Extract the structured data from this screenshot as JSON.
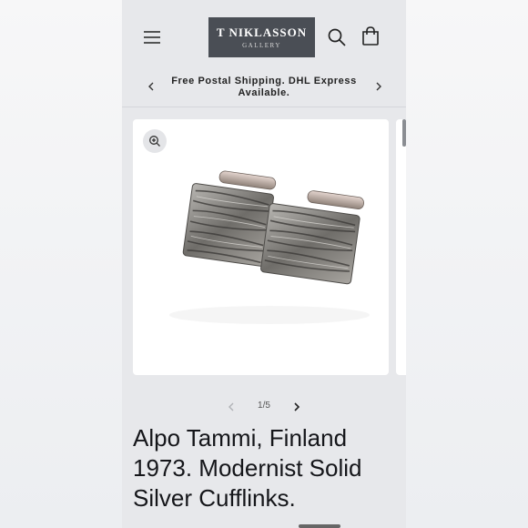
{
  "header": {
    "logo_title": "T NIKLASSON",
    "logo_subtitle": "GALLERY",
    "menu_icon": "hamburger-menu-icon",
    "search_icon": "search-icon",
    "cart_icon": "shopping-bag-icon"
  },
  "announcement": {
    "text": "Free Postal Shipping. DHL Express Available."
  },
  "gallery": {
    "zoom_icon": "zoom-in-icon",
    "image_alt": "Silver cufflinks"
  },
  "pager": {
    "counter": "1/5"
  },
  "product": {
    "title": "Alpo Tammi, Finland 1973. Modernist Solid Silver Cufflinks."
  },
  "colors": {
    "logo_bg": "#4a4e55",
    "page_bg": "#e7e8eb",
    "text": "#15161a"
  }
}
